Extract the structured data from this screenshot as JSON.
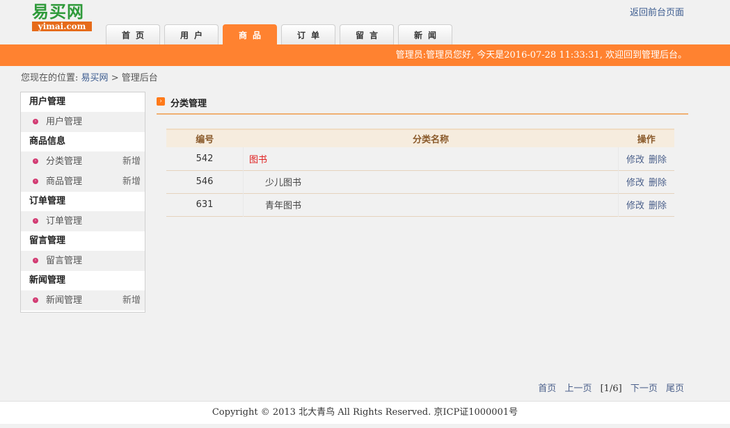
{
  "logo": {
    "cn": "易买网",
    "en": "yimai.com"
  },
  "header": {
    "front_link": "返回前台页面"
  },
  "nav": [
    {
      "label": "首页",
      "active": false
    },
    {
      "label": "用户",
      "active": false
    },
    {
      "label": "商品",
      "active": true
    },
    {
      "label": "订单",
      "active": false
    },
    {
      "label": "留言",
      "active": false
    },
    {
      "label": "新闻",
      "active": false
    }
  ],
  "welcome": "管理员:管理员您好, 今天是2016-07-28 11:33:31, 欢迎回到管理后台。",
  "breadcrumb": {
    "prefix": "您现在的位置:",
    "site": "易买网",
    "separator": ">",
    "current": "管理后台"
  },
  "sidebar": [
    {
      "title": "用户管理",
      "items": [
        {
          "label": "用户管理",
          "add": ""
        }
      ]
    },
    {
      "title": "商品信息",
      "items": [
        {
          "label": "分类管理",
          "add": "新增"
        },
        {
          "label": "商品管理",
          "add": "新增"
        }
      ]
    },
    {
      "title": "订单管理",
      "items": [
        {
          "label": "订单管理",
          "add": ""
        }
      ]
    },
    {
      "title": "留言管理",
      "items": [
        {
          "label": "留言管理",
          "add": ""
        }
      ]
    },
    {
      "title": "新闻管理",
      "items": [
        {
          "label": "新闻管理",
          "add": "新增"
        }
      ]
    }
  ],
  "main": {
    "title": "分类管理",
    "title_icon": "arrow-right-icon",
    "columns": [
      "编号",
      "分类名称",
      "操作"
    ],
    "rows": [
      {
        "id": "542",
        "name": "图书",
        "level": "top",
        "edit": "修改",
        "delete": "删除"
      },
      {
        "id": "546",
        "name": "少儿图书",
        "level": "sub",
        "edit": "修改",
        "delete": "删除"
      },
      {
        "id": "631",
        "name": "青年图书",
        "level": "sub",
        "edit": "修改",
        "delete": "删除"
      }
    ]
  },
  "pager": {
    "first": "首页",
    "prev": "上一页",
    "current": "[1/6]",
    "next": "下一页",
    "last": "尾页"
  },
  "footer": "Copyright © 2013 北大青鸟 All Rights Reserved. 京ICP证1000001号",
  "colors": {
    "accent": "#ff8230",
    "logo_green": "#2f9a3a",
    "bullet": "#d23c73",
    "link": "#4a5f8a"
  }
}
